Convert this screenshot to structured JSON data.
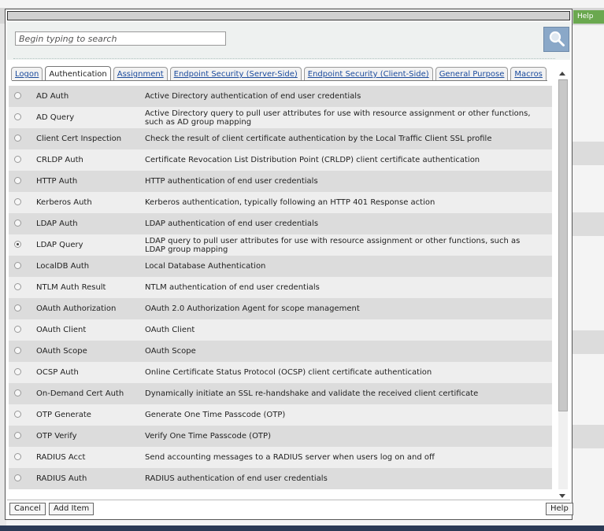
{
  "background": {
    "help_label": "Help"
  },
  "search": {
    "placeholder": "Begin typing to search",
    "value": ""
  },
  "tabs": [
    {
      "label": "Logon",
      "active": false
    },
    {
      "label": "Authentication",
      "active": true
    },
    {
      "label": "Assignment",
      "active": false
    },
    {
      "label": "Endpoint Security (Server-Side)",
      "active": false
    },
    {
      "label": "Endpoint Security (Client-Side)",
      "active": false
    },
    {
      "label": "General Purpose",
      "active": false
    },
    {
      "label": "Macros",
      "active": false
    }
  ],
  "items": [
    {
      "name": "AD Auth",
      "desc": "Active Directory authentication of end user credentials",
      "selected": false
    },
    {
      "name": "AD Query",
      "desc": "Active Directory query to pull user attributes for use with resource assignment or other functions, such as AD group mapping",
      "selected": false
    },
    {
      "name": "Client Cert Inspection",
      "desc": "Check the result of client certificate authentication by the Local Traffic Client SSL profile",
      "selected": false
    },
    {
      "name": "CRLDP Auth",
      "desc": "Certificate Revocation List Distribution Point (CRLDP) client certificate authentication",
      "selected": false
    },
    {
      "name": "HTTP Auth",
      "desc": "HTTP authentication of end user credentials",
      "selected": false
    },
    {
      "name": "Kerberos Auth",
      "desc": "Kerberos authentication, typically following an HTTP 401 Response action",
      "selected": false
    },
    {
      "name": "LDAP Auth",
      "desc": "LDAP authentication of end user credentials",
      "selected": false
    },
    {
      "name": "LDAP Query",
      "desc": "LDAP query to pull user attributes for use with resource assignment or other functions, such as LDAP group mapping",
      "selected": true
    },
    {
      "name": "LocalDB Auth",
      "desc": "Local Database Authentication",
      "selected": false
    },
    {
      "name": "NTLM Auth Result",
      "desc": "NTLM authentication of end user credentials",
      "selected": false
    },
    {
      "name": "OAuth Authorization",
      "desc": "OAuth 2.0 Authorization Agent for scope management",
      "selected": false
    },
    {
      "name": "OAuth Client",
      "desc": "OAuth Client",
      "selected": false
    },
    {
      "name": "OAuth Scope",
      "desc": "OAuth Scope",
      "selected": false
    },
    {
      "name": "OCSP Auth",
      "desc": "Online Certificate Status Protocol (OCSP) client certificate authentication",
      "selected": false
    },
    {
      "name": "On-Demand Cert Auth",
      "desc": "Dynamically initiate an SSL re-handshake and validate the received client certificate",
      "selected": false
    },
    {
      "name": "OTP Generate",
      "desc": "Generate One Time Passcode (OTP)",
      "selected": false
    },
    {
      "name": "OTP Verify",
      "desc": "Verify One Time Passcode (OTP)",
      "selected": false
    },
    {
      "name": "RADIUS Acct",
      "desc": "Send accounting messages to a RADIUS server when users log on and off",
      "selected": false
    },
    {
      "name": "RADIUS Auth",
      "desc": "RADIUS authentication of end user credentials",
      "selected": false
    }
  ],
  "footer": {
    "cancel_label": "Cancel",
    "add_label": "Add Item",
    "help_label": "Help"
  }
}
